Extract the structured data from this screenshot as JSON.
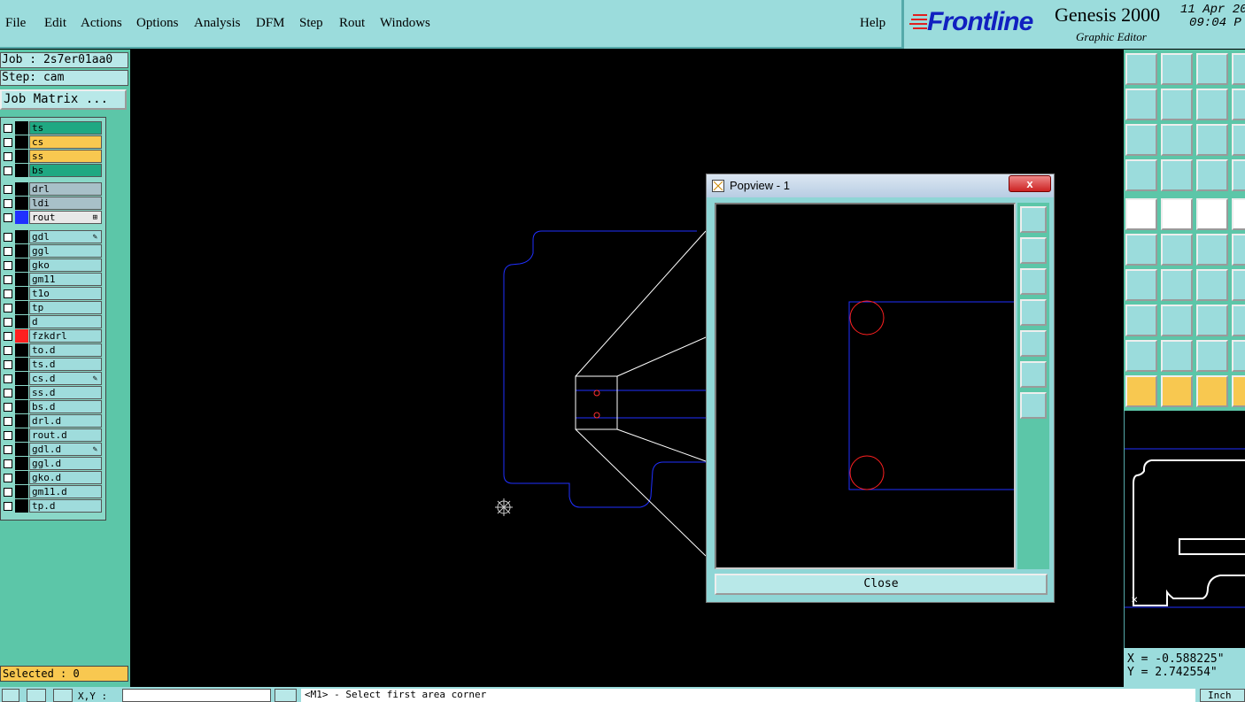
{
  "menu": {
    "items": [
      "File",
      "Edit",
      "Actions",
      "Options",
      "Analysis",
      "DFM",
      "Step",
      "Rout",
      "Windows"
    ],
    "help": "Help"
  },
  "brand": {
    "logo": "Frontline",
    "product": "Genesis 2000",
    "subtitle": "Graphic Editor",
    "date": "11 Apr 20",
    "time": "09:04 P"
  },
  "job": {
    "job_label": "Job : 2s7er01aa0",
    "step_label": "Step: cam",
    "matrix_button": "Job Matrix ..."
  },
  "layers": [
    {
      "name": "ts",
      "color": "#1fa882",
      "mark": ""
    },
    {
      "name": "cs",
      "color": "#f8c850",
      "mark": ""
    },
    {
      "name": "ss",
      "color": "#f8c850",
      "mark": ""
    },
    {
      "name": "bs",
      "color": "#1fa882",
      "mark": ""
    },
    {
      "name": "drl",
      "color": "#a8c0c8",
      "mark": ""
    },
    {
      "name": "ldi",
      "color": "#a8c0c8",
      "mark": ""
    },
    {
      "name": "rout",
      "color": "#e8e8e8",
      "mark": "⊞",
      "swatch": "#2030ff"
    },
    {
      "name": "gdl",
      "color": "#9fdcdc",
      "mark": "✎"
    },
    {
      "name": "ggl",
      "color": "#9fdcdc",
      "mark": ""
    },
    {
      "name": "gko",
      "color": "#9fdcdc",
      "mark": ""
    },
    {
      "name": "gm11",
      "color": "#9fdcdc",
      "mark": ""
    },
    {
      "name": "t1o",
      "color": "#9fdcdc",
      "mark": ""
    },
    {
      "name": "tp",
      "color": "#9fdcdc",
      "mark": ""
    },
    {
      "name": "d",
      "color": "#9fdcdc",
      "mark": ""
    },
    {
      "name": "fzkdrl",
      "color": "#9fdcdc",
      "mark": "",
      "swatch": "#ff2020"
    },
    {
      "name": "to.d",
      "color": "#9fdcdc",
      "mark": ""
    },
    {
      "name": "ts.d",
      "color": "#9fdcdc",
      "mark": ""
    },
    {
      "name": "cs.d",
      "color": "#9fdcdc",
      "mark": "✎"
    },
    {
      "name": "ss.d",
      "color": "#9fdcdc",
      "mark": ""
    },
    {
      "name": "bs.d",
      "color": "#9fdcdc",
      "mark": ""
    },
    {
      "name": "drl.d",
      "color": "#9fdcdc",
      "mark": ""
    },
    {
      "name": "rout.d",
      "color": "#9fdcdc",
      "mark": ""
    },
    {
      "name": "gdl.d",
      "color": "#9fdcdc",
      "mark": "✎"
    },
    {
      "name": "ggl.d",
      "color": "#9fdcdc",
      "mark": ""
    },
    {
      "name": "gko.d",
      "color": "#9fdcdc",
      "mark": ""
    },
    {
      "name": "gm11.d",
      "color": "#9fdcdc",
      "mark": ""
    },
    {
      "name": "tp.d",
      "color": "#9fdcdc",
      "mark": ""
    }
  ],
  "selected": "Selected : 0",
  "popview": {
    "title": "Popview - 1",
    "close_x": "x",
    "close_button": "Close"
  },
  "coords": {
    "x": "X = -0.588225\"",
    "y": "Y = 2.742554\""
  },
  "status": {
    "xy_label": "X,Y :",
    "prompt": "<M1> - Select first area corner",
    "units": "Inch"
  },
  "colors": {
    "panel": "#9bdcdc",
    "accent_green": "#5cc6a8",
    "outline_blue": "#2030ff",
    "drill_red": "#ff2020"
  }
}
